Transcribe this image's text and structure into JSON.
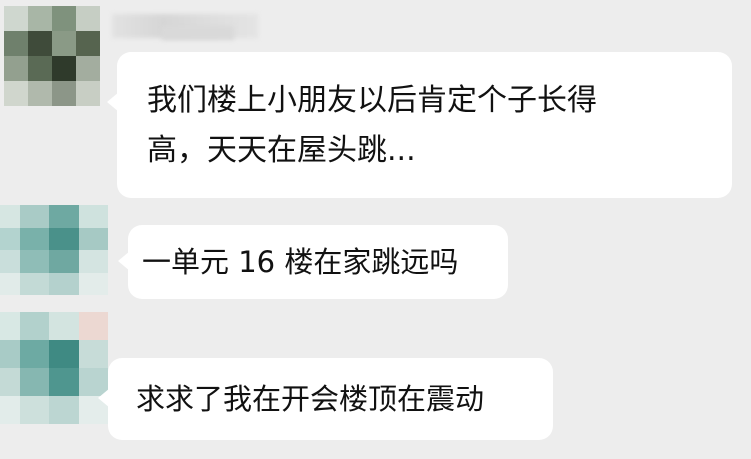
{
  "chat": {
    "messages": [
      {
        "lines": [
          "我们楼上小朋友以后肯定个子长得",
          "高，天天在屋头跳..."
        ]
      },
      {
        "text": "一单元 16 楼在家跳远吗"
      },
      {
        "text": "求求了我在开会楼顶在震动"
      }
    ]
  },
  "colors": {
    "background": "#ededed",
    "bubble": "#ffffff",
    "text": "#111111"
  }
}
